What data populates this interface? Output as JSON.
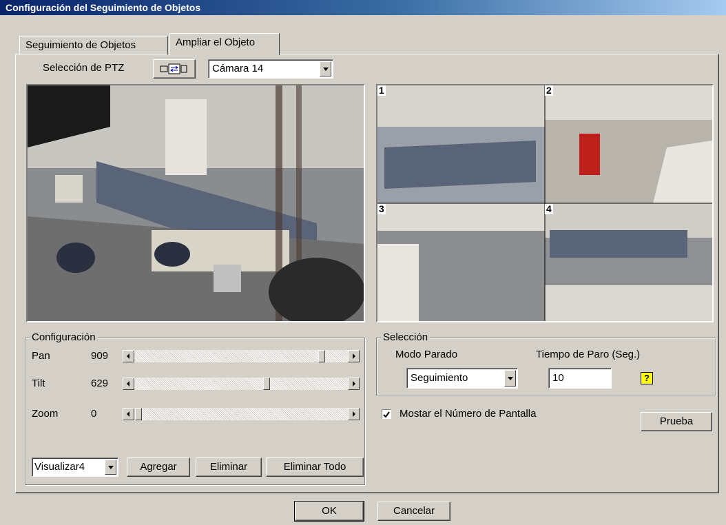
{
  "window": {
    "title": "Configuración del Seguimiento de Objetos"
  },
  "tabs": [
    {
      "label": "Seguimiento de Objetos",
      "active": false
    },
    {
      "label": "Ampliar el Objeto",
      "active": true
    }
  ],
  "ptz": {
    "label": "Selección de PTZ",
    "camera": "Cámara 14"
  },
  "quad": {
    "numbers": [
      "1",
      "2",
      "3",
      "4"
    ]
  },
  "config": {
    "legend": "Configuración",
    "pan": {
      "label": "Pan",
      "value": "909"
    },
    "tilt": {
      "label": "Tilt",
      "value": "629"
    },
    "zoom": {
      "label": "Zoom",
      "value": "0"
    },
    "view_select": "Visualizar4",
    "add_button": "Agregar",
    "delete_button": "Eliminar",
    "delete_all_button": "Eliminar Todo"
  },
  "selection": {
    "legend": "Selección",
    "mode_label": "Modo Parado",
    "time_label": "Tiempo de Paro (Seg.)",
    "mode_value": "Seguimiento",
    "time_value": "10"
  },
  "show_number": {
    "label": "Mostar el Número de Pantalla",
    "checked": true
  },
  "test_button": "Prueba",
  "ok_button": "OK",
  "cancel_button": "Cancelar",
  "colors": {
    "title_start": "#0a246a",
    "title_end": "#a6caf0",
    "face": "#d4d0c8",
    "help": "#ffff00"
  }
}
